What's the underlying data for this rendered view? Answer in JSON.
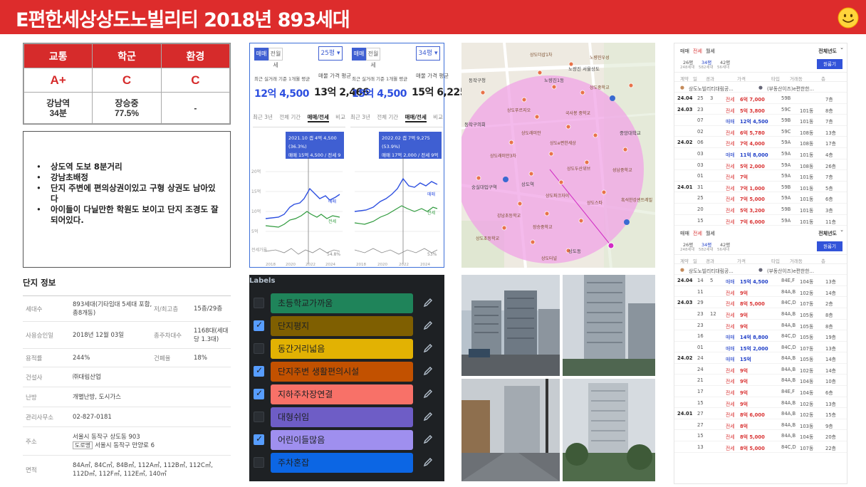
{
  "header": {
    "title": "E편한세상상도노빌리티 2018년 893세대",
    "background_color": "#dd2c2c",
    "smiley_icon": "smiley-face-icon"
  },
  "stats": {
    "columns": [
      "교통",
      "학군",
      "환경"
    ],
    "grades": [
      "A+",
      "C",
      "C"
    ],
    "details": [
      [
        "강남역",
        "34분"
      ],
      [
        "장승중",
        "77.5%"
      ],
      [
        "-",
        ""
      ]
    ]
  },
  "notes": [
    "상도역 도보 8분거리",
    "강남초배정",
    "단지 주변에 편의상권이있고 구형 상권도 남아있다",
    "아이들이 다닐만한 학원도 보이고 단지 조경도 잘 되어있다."
  ],
  "complex_info": {
    "title": "단지 정보",
    "rows": [
      {
        "k": "세대수",
        "v": "893세대(기타임대 5세대 포함, 총8개동)",
        "k2": "저/최고층",
        "v2": "15층/29층"
      },
      {
        "k": "사용승인일",
        "v": "2018년 12월 03일",
        "k2": "총주차대수",
        "v2": "1168대(세대당 1.3대)"
      },
      {
        "k": "용적률",
        "v": "244%",
        "k2": "건폐율",
        "v2": "18%"
      },
      {
        "k": "건설사",
        "v": "㈜대림산업"
      },
      {
        "k": "난방",
        "v": "개별난방, 도시가스"
      },
      {
        "k": "관리사무소",
        "v": "02-827-0181"
      },
      {
        "k": "주소",
        "v": "서울시 동작구 상도동 903",
        "road_tag": "도로명",
        "road": "서울시 동작구 만양로 6"
      },
      {
        "k": "면적",
        "v": "84A㎡, 84C㎡, 84B㎡, 112A㎡, 112B㎡, 112C㎡, 112D㎡, 112F㎡, 112E㎡, 140㎡"
      }
    ]
  },
  "charts": {
    "tab_sale": "매매",
    "tab_jeonse": "전월세",
    "range_tabs": [
      "최근 3년",
      "전체 기간",
      "매매/전세",
      "비교"
    ],
    "range_active": 2,
    "recent_label": "최근 실거래 기준 1개월 평균",
    "ask_label": "매물 가격 평균",
    "panes": [
      {
        "size": "25평",
        "recent": "12억 4,500",
        "ask": "13억 2,466",
        "tooltip_line1": "2021.10 갭 4억 4,500 (36.3%)",
        "tooltip_line2": "매매 15억 4,500 / 전세 9억"
      },
      {
        "size": "34평",
        "recent": "15억 4,500",
        "ask": "15억 6,225",
        "tooltip_line1": "2022.02 갭 7억 9,275 (53.9%)",
        "tooltip_line2": "매매 17억 2,000 / 전세 9억 2,725"
      }
    ],
    "y_ticks": [
      "20억",
      "15억",
      "10억",
      "5억",
      "0",
      "전세가율"
    ],
    "x_ticks": [
      "2018",
      "2020",
      "2022",
      "2024"
    ],
    "legend": {
      "sale": "매매",
      "jeonse": "전세",
      "ratio_left": "54.8%",
      "ratio_right": "53%",
      "ratio_label": "평균"
    },
    "sale_color": "#2d4fe0",
    "jeonse_color": "#2e9a3c"
  },
  "map": {
    "labels": [
      "상도더샵1차",
      "노량진 서울상도",
      "노량진1동",
      "노량진우성",
      "동작구청",
      "상도중학교",
      "상도푸르지오",
      "국사봉 중학교",
      "동작구의회",
      "상도래미안",
      "상도e편한세상",
      "상도래미안3차",
      "상도두산위브",
      "숭실대입구역",
      "성남중학교",
      "상도역",
      "상도파크자이",
      "상도스타",
      "강남초등학교",
      "장승중학교",
      "상도초등학교",
      "중앙대학교",
      "흑석한강센트레빌",
      "상도동",
      "상도터널"
    ],
    "radius_color": "#f0a3e6"
  },
  "board": {
    "title": "Labels",
    "labels": [
      {
        "text": "초등학교가까움",
        "color": "#1f845a",
        "checked": false
      },
      {
        "text": "단지평지",
        "color": "#7f5f01",
        "checked": true
      },
      {
        "text": "동간거리넓음",
        "color": "#e2b203",
        "checked": false
      },
      {
        "text": "단지주변 생활편의시설",
        "color": "#c25100",
        "checked": true
      },
      {
        "text": "지하주차장연결",
        "color": "#f87168",
        "checked": true
      },
      {
        "text": "대형쉬임",
        "color": "#6e5dc6",
        "checked": false
      },
      {
        "text": "어린이들많음",
        "color": "#9f8fef",
        "checked": true
      },
      {
        "text": "주차혼잡",
        "color": "#0c66e4",
        "checked": false
      }
    ]
  },
  "transactions": {
    "tabs": [
      "매매",
      "전세",
      "월세"
    ],
    "year_filter": "전체년도",
    "apply_button": "원룸기",
    "table_headers": [
      "계약",
      "일",
      "경과",
      "가격",
      "타입",
      "거래동",
      "층"
    ],
    "sections": [
      {
        "sizes": [
          {
            "p": "26평",
            "n": "248세대"
          },
          {
            "p": "34평",
            "n": "582세대"
          },
          {
            "p": "42평",
            "n": "56세대"
          }
        ],
        "agency": "상도노빌리티대림공...",
        "agency2": "(부동산이즈)e편한한...",
        "rows": [
          {
            "m": "24.04",
            "d": "25",
            "e": "3",
            "t": "전세",
            "p": "6억 7,000",
            "ty": "59B",
            "dong": "",
            "f": "7층"
          },
          {
            "m": "24.03",
            "d": "23",
            "e": "",
            "t": "전세",
            "p": "5억 3,800",
            "ty": "59C",
            "dong": "101동",
            "f": "8층"
          },
          {
            "m": "",
            "d": "07",
            "e": "",
            "t": "매매",
            "p": "12억 4,500",
            "ty": "59B",
            "dong": "101동",
            "f": "7층"
          },
          {
            "m": "",
            "d": "02",
            "e": "",
            "t": "전세",
            "p": "6억 5,780",
            "ty": "59C",
            "dong": "108동",
            "f": "13층"
          },
          {
            "m": "24.02",
            "d": "06",
            "e": "",
            "t": "전세",
            "p": "7억 4,000",
            "ty": "59A",
            "dong": "108동",
            "f": "17층"
          },
          {
            "m": "",
            "d": "03",
            "e": "",
            "t": "매매",
            "p": "11억 8,000",
            "ty": "59A",
            "dong": "101동",
            "f": "4층"
          },
          {
            "m": "",
            "d": "03",
            "e": "",
            "t": "전세",
            "p": "5억 2,000",
            "ty": "59A",
            "dong": "108동",
            "f": "26층"
          },
          {
            "m": "",
            "d": "01",
            "e": "",
            "t": "전세",
            "p": "7억",
            "ty": "59A",
            "dong": "101동",
            "f": "7층"
          },
          {
            "m": "24.01",
            "d": "31",
            "e": "",
            "t": "전세",
            "p": "7억 1,000",
            "ty": "59B",
            "dong": "101동",
            "f": "5층"
          },
          {
            "m": "",
            "d": "25",
            "e": "",
            "t": "전세",
            "p": "7억 5,000",
            "ty": "59A",
            "dong": "101동",
            "f": "6층"
          },
          {
            "m": "",
            "d": "20",
            "e": "",
            "t": "전세",
            "p": "5억 3,200",
            "ty": "59B",
            "dong": "101동",
            "f": "3층"
          },
          {
            "m": "",
            "d": "15",
            "e": "",
            "t": "전세",
            "p": "7억 6,000",
            "ty": "59A",
            "dong": "101동",
            "f": "11층"
          }
        ]
      },
      {
        "sizes": [
          {
            "p": "26평",
            "n": "248세대"
          },
          {
            "p": "34평",
            "n": "582세대"
          },
          {
            "p": "42평",
            "n": "56세대"
          }
        ],
        "agency": "상도노빌리티대림공...",
        "agency2": "(부동산이즈)e편한한...",
        "rows": [
          {
            "m": "24.04",
            "d": "14",
            "e": "5",
            "t": "매매",
            "p": "15억 4,500",
            "ty": "84E,F",
            "dong": "104동",
            "f": "13층"
          },
          {
            "m": "",
            "d": "11",
            "e": "",
            "t": "전세",
            "p": "9억",
            "ty": "84A,B",
            "dong": "102동",
            "f": "14층"
          },
          {
            "m": "24.03",
            "d": "29",
            "e": "",
            "t": "전세",
            "p": "8억 5,000",
            "ty": "84C,D",
            "dong": "107동",
            "f": "2층"
          },
          {
            "m": "",
            "d": "23",
            "e": "12",
            "t": "전세",
            "p": "9억",
            "ty": "84A,B",
            "dong": "105동",
            "f": "8층"
          },
          {
            "m": "",
            "d": "23",
            "e": "",
            "t": "전세",
            "p": "9억",
            "ty": "84A,B",
            "dong": "105동",
            "f": "8층"
          },
          {
            "m": "",
            "d": "16",
            "e": "",
            "t": "매매",
            "p": "14억 8,800",
            "ty": "84C,D",
            "dong": "105동",
            "f": "19층"
          },
          {
            "m": "",
            "d": "01",
            "e": "",
            "t": "매매",
            "p": "15억 2,000",
            "ty": "84C,D",
            "dong": "107동",
            "f": "13층"
          },
          {
            "m": "24.02",
            "d": "24",
            "e": "",
            "t": "매매",
            "p": "15억",
            "ty": "84A,B",
            "dong": "105동",
            "f": "14층"
          },
          {
            "m": "",
            "d": "24",
            "e": "",
            "t": "전세",
            "p": "9억",
            "ty": "84A,B",
            "dong": "102동",
            "f": "14층"
          },
          {
            "m": "",
            "d": "21",
            "e": "",
            "t": "전세",
            "p": "9억",
            "ty": "84A,B",
            "dong": "104동",
            "f": "10층"
          },
          {
            "m": "",
            "d": "17",
            "e": "",
            "t": "전세",
            "p": "9억",
            "ty": "84E,F",
            "dong": "104동",
            "f": "6층"
          },
          {
            "m": "",
            "d": "15",
            "e": "",
            "t": "전세",
            "p": "9억",
            "ty": "84A,B",
            "dong": "102동",
            "f": "13층"
          },
          {
            "m": "24.01",
            "d": "27",
            "e": "",
            "t": "전세",
            "p": "8억 6,000",
            "ty": "84A,B",
            "dong": "102동",
            "f": "15층"
          },
          {
            "m": "",
            "d": "27",
            "e": "",
            "t": "전세",
            "p": "8억",
            "ty": "84A,B",
            "dong": "103동",
            "f": "9층"
          },
          {
            "m": "",
            "d": "15",
            "e": "",
            "t": "전세",
            "p": "8억 5,000",
            "ty": "84A,B",
            "dong": "104동",
            "f": "20층"
          },
          {
            "m": "",
            "d": "13",
            "e": "",
            "t": "전세",
            "p": "8억 5,000",
            "ty": "84C,D",
            "dong": "107동",
            "f": "22층"
          }
        ]
      }
    ]
  }
}
